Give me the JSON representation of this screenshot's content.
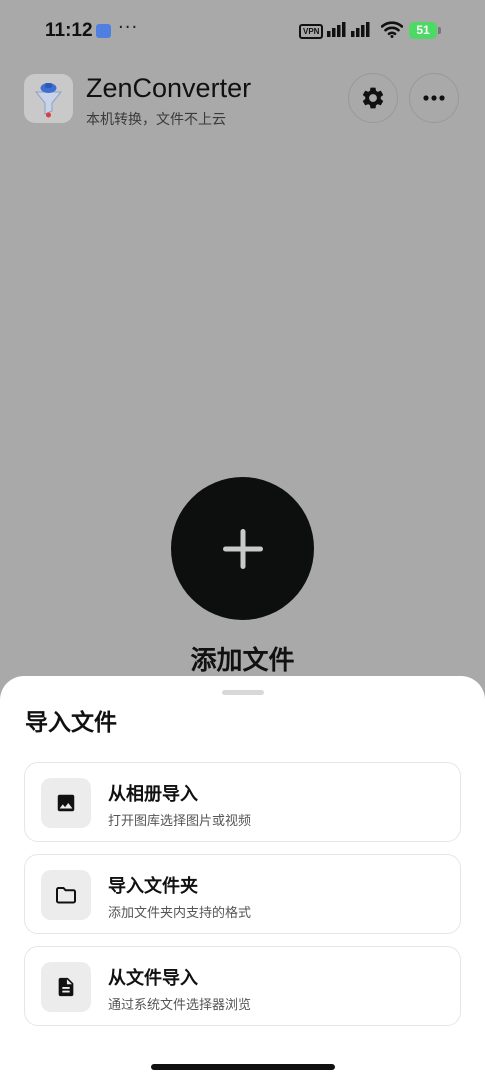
{
  "status_bar": {
    "time": "11:12",
    "notification_dots": "···",
    "vpn_label": "VPN",
    "battery": "51",
    "battery_color": "#4cd964"
  },
  "header": {
    "app_name": "ZenConverter",
    "subtitle": "本机转换，文件不上云",
    "settings_icon": "gear-icon",
    "more_icon": "more-horizontal-icon"
  },
  "main": {
    "add_icon": "plus-icon",
    "add_label": "添加文件"
  },
  "sheet": {
    "title": "导入文件",
    "options": [
      {
        "icon": "image-icon",
        "label": "从相册导入",
        "description": "打开图库选择图片或视频"
      },
      {
        "icon": "folder-icon",
        "label": "导入文件夹",
        "description": "添加文件夹内支持的格式"
      },
      {
        "icon": "document-icon",
        "label": "从文件导入",
        "description": "通过系统文件选择器浏览"
      }
    ]
  },
  "colors": {
    "overlay_background": "#a9a9a9",
    "add_button": "#0d0f0f",
    "sheet_background": "#ffffff"
  }
}
